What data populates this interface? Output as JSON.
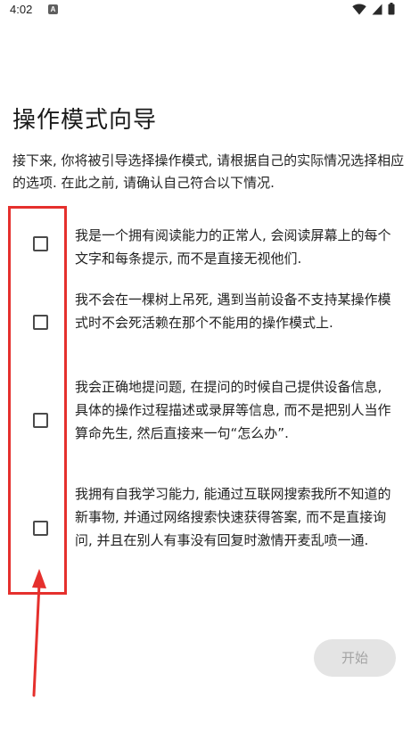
{
  "status_bar": {
    "time": "4:02",
    "notification_icon": "a-icon",
    "icons": [
      "wifi-icon",
      "signal-icon",
      "battery-icon"
    ]
  },
  "page": {
    "title": "操作模式向导",
    "intro": "接下来, 你将被引导选择操作模式, 请根据自己的实际情况选择相应的选项. 在此之前, 请确认自己符合以下情况."
  },
  "options": [
    {
      "text": "我是一个拥有阅读能力的正常人, 会阅读屏幕上的每个文字和每条提示, 而不是直接无视他们.",
      "checked": false
    },
    {
      "text": "我不会在一棵树上吊死, 遇到当前设备不支持某操作模式时不会死活赖在那个不能用的操作模式上.",
      "checked": false
    },
    {
      "text": "我会正确地提问题, 在提问的时候自己提供设备信息, 具体的操作过程描述或录屏等信息, 而不是把别人当作算命先生, 然后直接来一句“怎么办”.",
      "checked": false
    },
    {
      "text": "我拥有自我学习能力, 能通过互联网搜索我所不知道的新事物, 并通过网络搜索快速获得答案, 而不是直接询问, 并且在别人有事没有回复时激情开麦乱喷一通.",
      "checked": false
    }
  ],
  "actions": {
    "start_label": "开始",
    "start_enabled": false
  },
  "colors": {
    "background": "#ffffff",
    "text": "#222222",
    "button_disabled_bg": "#e4e4e4",
    "button_disabled_text": "#a4a4a4",
    "annotation_red": "#e5302d"
  }
}
